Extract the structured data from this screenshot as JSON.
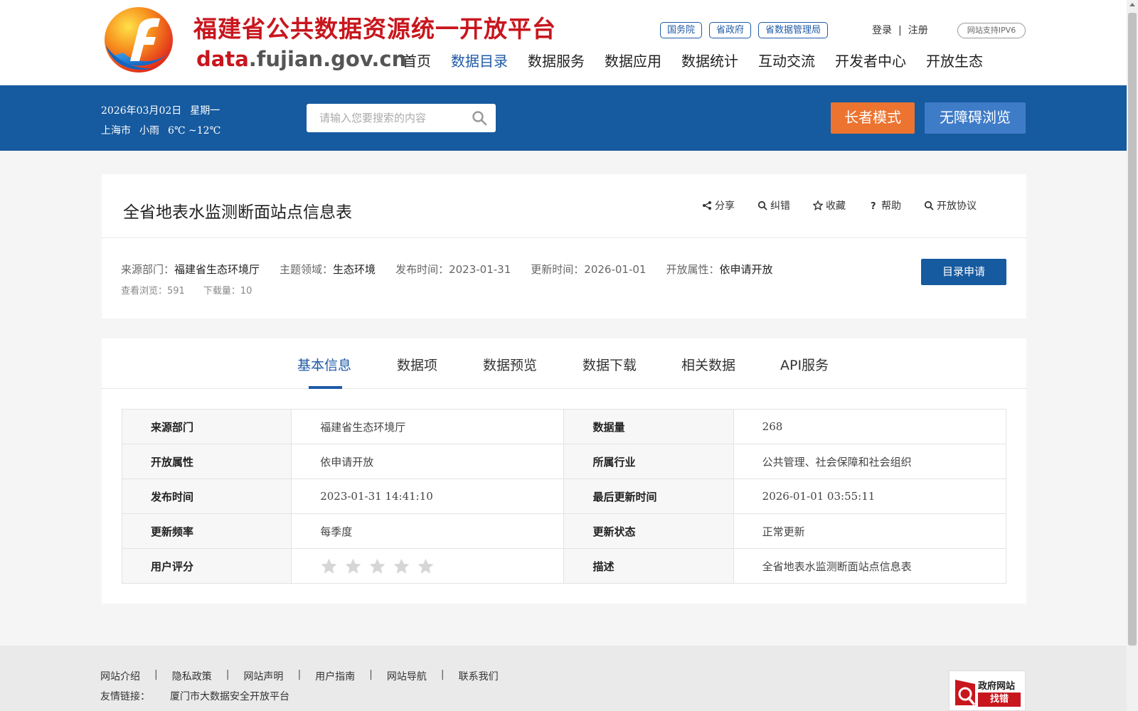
{
  "header": {
    "site_title": "福建省公共数据资源统一开放平台",
    "domain_accent": "data",
    "domain_rest": ".fujian.gov.cn",
    "gov_links": [
      "国务院",
      "省政府",
      "省数据管理局"
    ],
    "login": "登录",
    "auth_sep": "|",
    "register": "注册",
    "ipv6": "网站支持IPV6",
    "nav": [
      "首页",
      "数据目录",
      "数据服务",
      "数据应用",
      "数据统计",
      "互动交流",
      "开发者中心",
      "开放生态"
    ],
    "active_nav": "数据目录"
  },
  "band": {
    "date": "2026年03月02日",
    "weekday": "星期一",
    "city": "上海市",
    "weather": "小雨",
    "temp": "6℃ ~12℃",
    "search_placeholder": "请输入您要搜索的内容",
    "elder_mode": "长者模式",
    "accessible": "无障碍浏览"
  },
  "dataset": {
    "title": "全省地表水监测断面站点信息表",
    "actions": [
      "分享",
      "纠错",
      "收藏",
      "帮助",
      "开放协议"
    ],
    "meta": {
      "source_label": "来源部门：",
      "source": "福建省生态环境厅",
      "domain_label": "主题领域：",
      "domain": "生态环境",
      "publish_label": "发布时间：",
      "publish": "2023-01-31",
      "update_label": "更新时间：",
      "update": "2026-01-01",
      "open_label": "开放属性：",
      "open": "依申请开放"
    },
    "views_label": "查看浏览：",
    "views": "591",
    "downloads_label": "下载量：",
    "downloads": "10",
    "apply_button": "目录申请"
  },
  "tabs": [
    "基本信息",
    "数据项",
    "数据预览",
    "数据下载",
    "相关数据",
    "API服务"
  ],
  "active_tab": "基本信息",
  "info": {
    "rows": [
      [
        "来源部门",
        "福建省生态环境厅",
        "数据量",
        "268"
      ],
      [
        "开放属性",
        "依申请开放",
        "所属行业",
        "公共管理、社会保障和社会组织"
      ],
      [
        "发布时间",
        "2023-01-31 14:41:10",
        "最后更新时间",
        "2026-01-01 03:55:11"
      ],
      [
        "更新频率",
        "每季度",
        "更新状态",
        "正常更新"
      ],
      [
        "用户评分",
        "",
        "描述",
        "全省地表水监测断面站点信息表"
      ]
    ],
    "rating": 0,
    "rating_max": 5
  },
  "footer": {
    "links": [
      "网站介绍",
      "隐私政策",
      "网站声明",
      "用户指南",
      "网站导航",
      "联系我们"
    ],
    "link_sep": "|",
    "friend_label": "友情链接：",
    "friend_link": "厦门市大数据安全开放平台",
    "badge_line1": "政府网站",
    "badge_line2": "找错"
  },
  "colors": {
    "primary_blue": "#165a9f",
    "link_blue": "#1f5aa6",
    "title_red": "#c8161d",
    "elder_orange": "#ec7430",
    "accessible_blue": "#3f7cc8"
  },
  "icons": {
    "actions": [
      "share-icon",
      "search-icon",
      "star-icon",
      "question-icon",
      "search-icon"
    ]
  }
}
